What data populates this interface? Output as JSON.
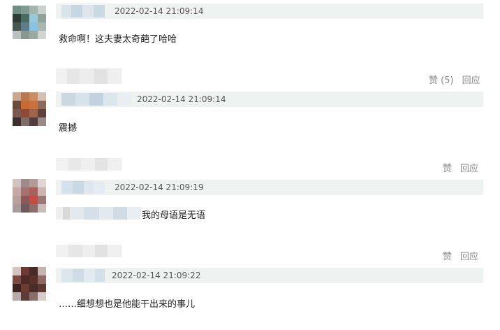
{
  "comments": [
    {
      "timestamp": "2022-02-14 21:09:14",
      "text": "救命啊！这夫妻太奇葩了哈哈"
    },
    {
      "timestamp": "2022-02-14 21:09:14",
      "text": "震撼",
      "like_label": "赞 (5)",
      "reply_label": "回应"
    },
    {
      "timestamp": "2022-02-14 21:09:19",
      "text": "我的母语是无语",
      "like_label": "赞",
      "reply_label": "回应"
    },
    {
      "timestamp": "2022-02-14 21:09:22",
      "text": "……细想想也是他能干出来的事儿",
      "like_label": "赞",
      "reply_label": "回应"
    }
  ]
}
